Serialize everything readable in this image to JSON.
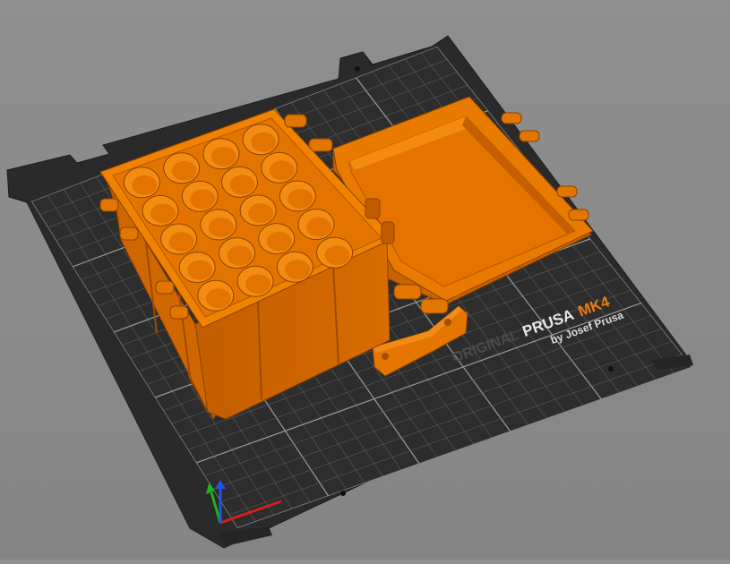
{
  "viewport": {
    "background_color": "#8c8c8c",
    "bed_color": "#2b2b2b",
    "grid_color": "#9a9a9a",
    "model_color": "#e87a00"
  },
  "bed_logo": {
    "brand_prefix": "ORIGINAL",
    "brand_name": "PRUSA",
    "model": "MK4",
    "byline": "by Josef Prusa",
    "model_color": "#ec7a12"
  },
  "axes": {
    "x_color": "#d21f1f",
    "y_color": "#1fb21f",
    "z_color": "#2255e0"
  },
  "objects": [
    {
      "name": "box-base-with-holes",
      "hole_count": 20
    },
    {
      "name": "box-lid"
    },
    {
      "name": "latch-part"
    }
  ]
}
